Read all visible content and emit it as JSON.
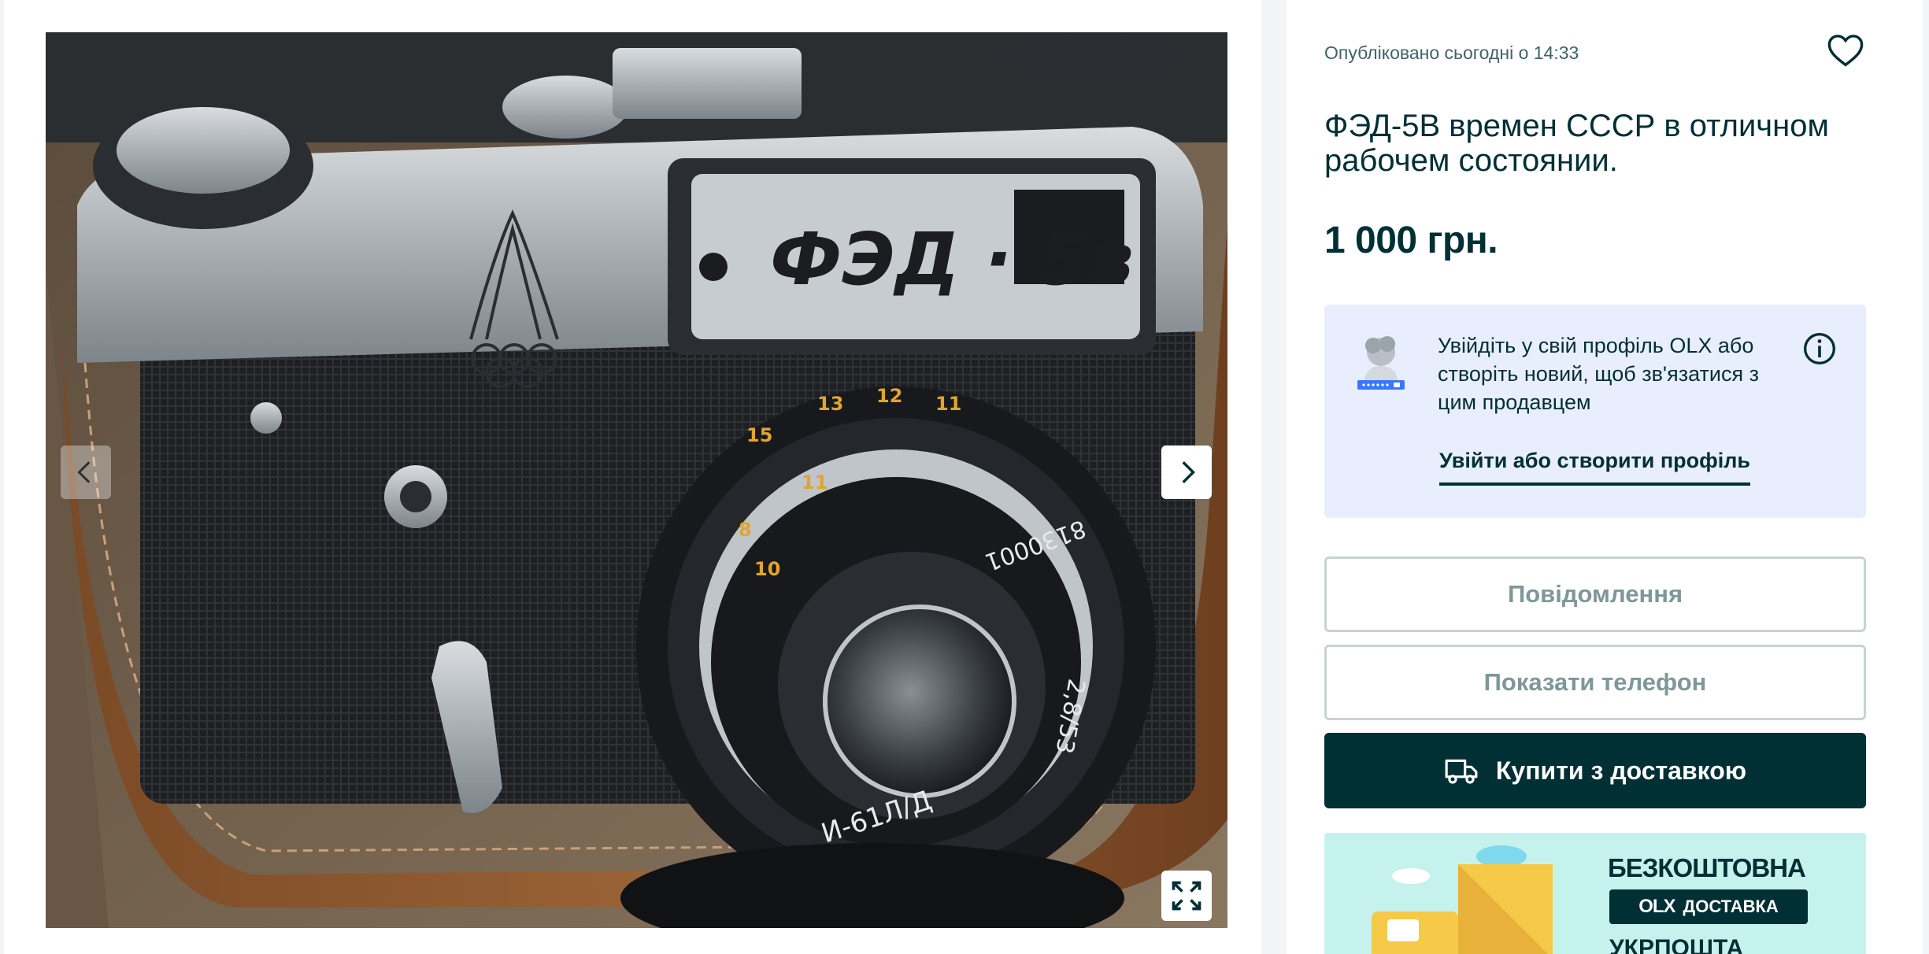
{
  "listing": {
    "published": "Опубліковано сьогодні о 14:33",
    "title": "ФЭД-5В времен СССР в отличном рабочем состоянии.",
    "price": "1 000 грн."
  },
  "photo": {
    "camera_label": "ФЭД · 5в",
    "lens_text": "И-61Л/Д",
    "lens_serial": "8130001",
    "lens_spec": "2,8/53"
  },
  "login_prompt": {
    "text": "Увійдіть у свій профіль OLX або створіть новий, щоб зв'язатися з цим продавцем",
    "link": "Увійти або створити профіль"
  },
  "actions": {
    "message": "Повідомлення",
    "phone": "Показати телефон",
    "buy_delivery": "Купити з доставкою"
  },
  "promo": {
    "title": "БЕЗКОШТОВНА",
    "badge_logo": "OLX",
    "badge_text": "ДОСТАВКА",
    "partner": "УКРПОШТА"
  },
  "colors": {
    "primary": "#002f34",
    "login_bg": "#e8eefe",
    "promo_bg": "#c5f2ec",
    "outline": "#c7d3d5"
  },
  "icons": [
    "chevron-left-icon",
    "chevron-right-icon",
    "expand-icon",
    "heart-icon",
    "info-icon",
    "truck-icon",
    "avatar-icon"
  ]
}
